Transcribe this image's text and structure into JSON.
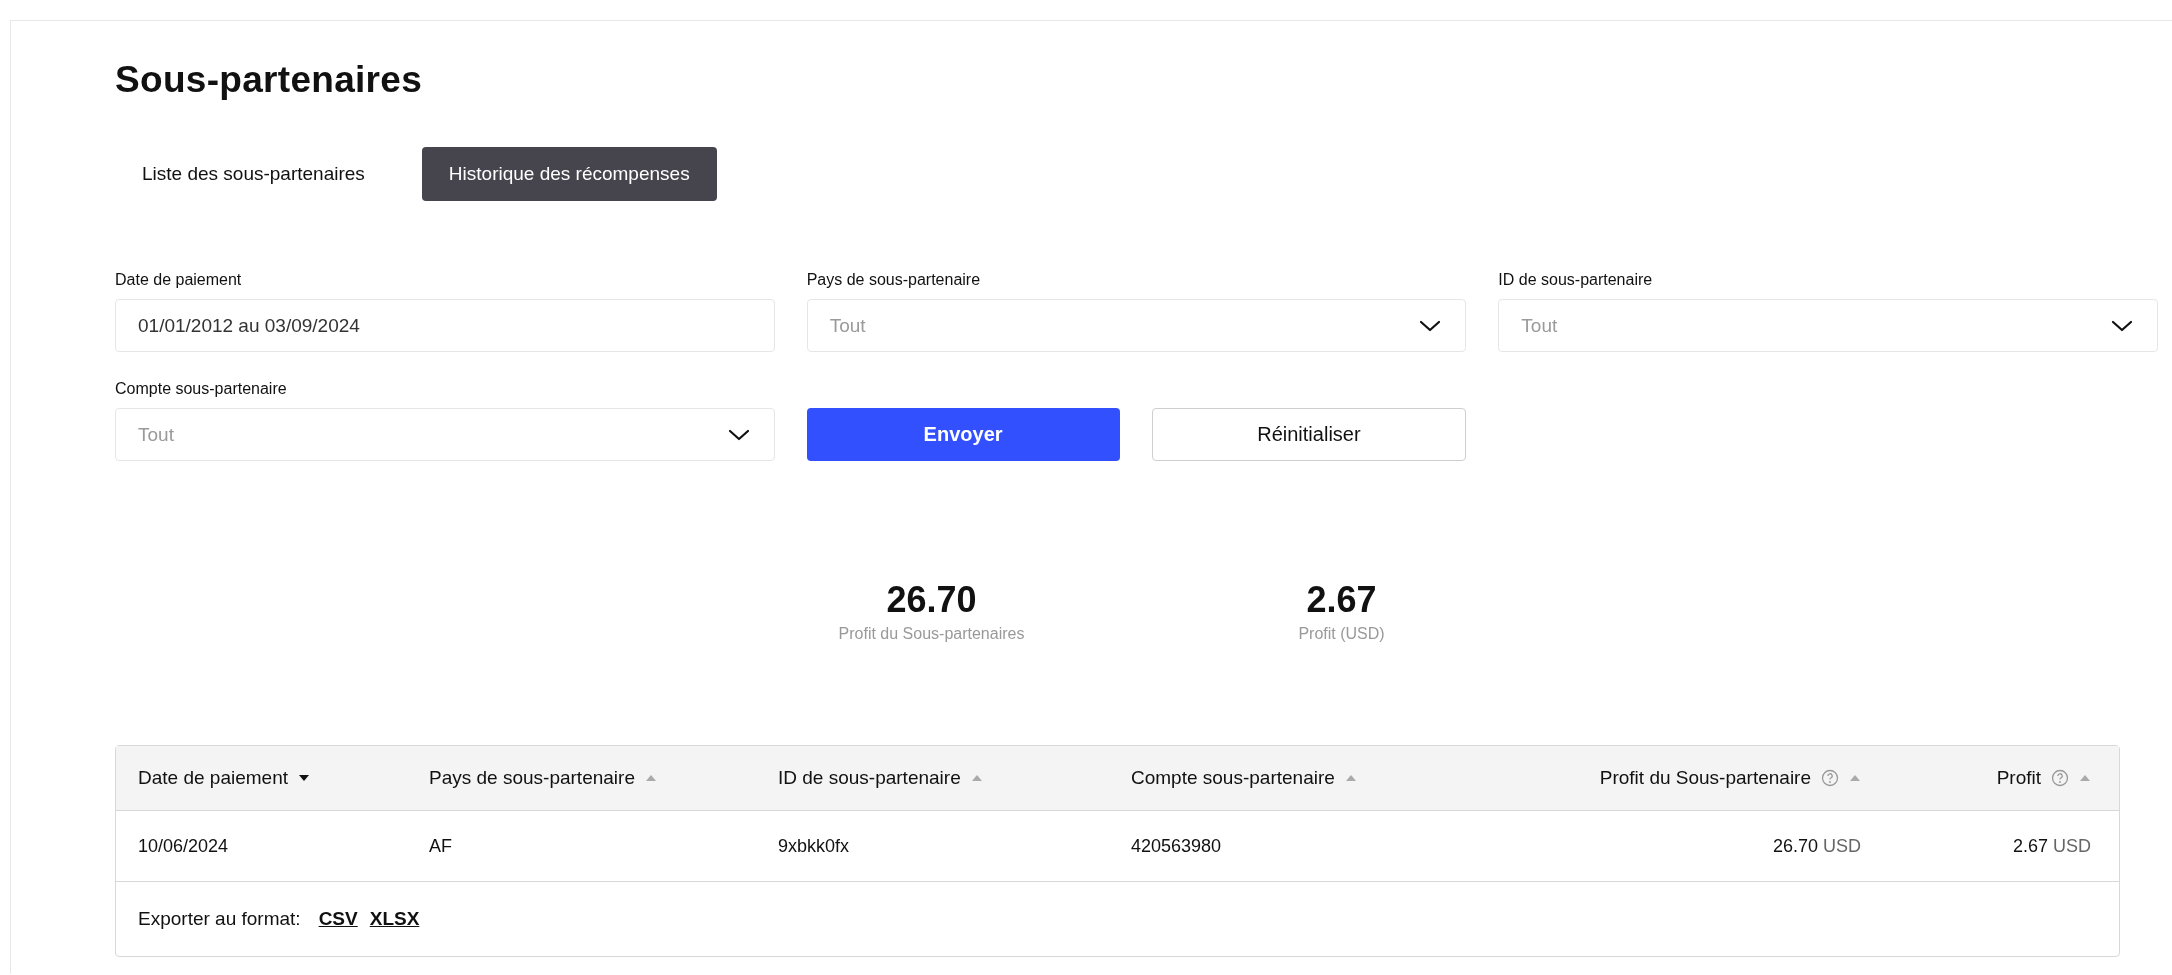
{
  "page_title": "Sous-partenaires",
  "tabs": [
    {
      "label": "Liste des sous-partenaires",
      "selected": false
    },
    {
      "label": "Historique des récompenses",
      "selected": true
    }
  ],
  "filters": [
    {
      "label": "Date de paiement",
      "kind": "date",
      "value": "01/01/2012 au 03/09/2024"
    },
    {
      "label": "Pays de sous-partenaire",
      "kind": "select",
      "placeholder": "Tout"
    },
    {
      "label": "ID de sous-partenaire",
      "kind": "select",
      "placeholder": "Tout"
    },
    {
      "label": "Compte sous-partenaire",
      "kind": "select",
      "placeholder": "Tout"
    }
  ],
  "buttons": [
    {
      "label": "Envoyer",
      "kind": "primary"
    },
    {
      "label": "Réinitialiser",
      "kind": "secondary"
    }
  ],
  "stats": [
    {
      "value": "26.70",
      "label": "Profit du Sous-partenaires"
    },
    {
      "value": "2.67",
      "label": "Profit (USD)"
    }
  ],
  "table": {
    "columns": [
      {
        "label": "Date de paiement",
        "kind": "text",
        "sorted": true
      },
      {
        "label": "Pays de sous-partenaire",
        "kind": "text",
        "sorted": false
      },
      {
        "label": "ID de sous-partenaire",
        "kind": "text",
        "sorted": false
      },
      {
        "label": "Compte sous-partenaire",
        "kind": "text",
        "sorted": false
      },
      {
        "label": "Profit du Sous-partenaire",
        "kind": "amount",
        "sorted": false
      },
      {
        "label": "Profit",
        "kind": "amount",
        "sorted": false
      }
    ],
    "rows": [
      {
        "cells": [
          {
            "value": "10/06/2024"
          },
          {
            "value": "AF"
          },
          {
            "value": "9xbkk0fx"
          },
          {
            "value": "420563980"
          },
          {
            "value": "26.70",
            "unit": "USD"
          },
          {
            "value": "2.67",
            "unit": "USD"
          }
        ]
      }
    ],
    "export": {
      "label": "Exporter au format:",
      "formats": [
        "CSV",
        "XLSX"
      ]
    }
  }
}
